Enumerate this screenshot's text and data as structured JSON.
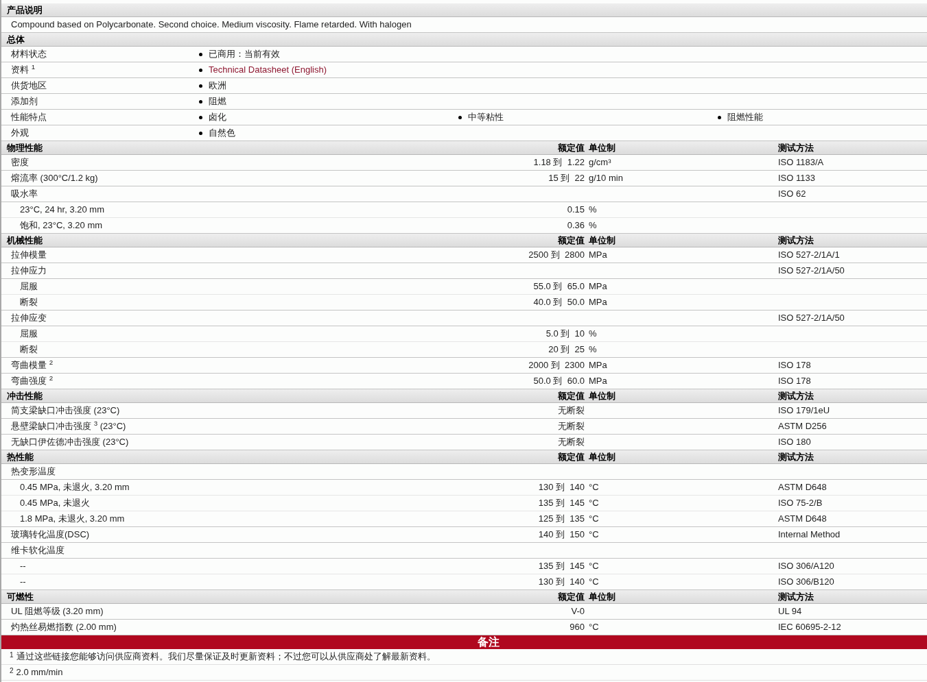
{
  "product_description": {
    "title": "产品说明",
    "text": "Compound based on Polycarbonate. Second choice. Medium viscosity. Flame retarded. With halogen"
  },
  "general": {
    "title": "总体",
    "rows": [
      {
        "label": "材料状态",
        "values": [
          {
            "text": "已商用：当前有效",
            "kind": "text"
          }
        ]
      },
      {
        "label": "资料 $^{1}$",
        "values": [
          {
            "text": "Technical Datasheet (English)",
            "kind": "link"
          }
        ]
      },
      {
        "label": "供货地区",
        "values": [
          {
            "text": "欧洲",
            "kind": "text"
          }
        ]
      },
      {
        "label": "添加剂",
        "values": [
          {
            "text": "阻燃",
            "kind": "text"
          }
        ]
      },
      {
        "label": "性能特点",
        "values": [
          {
            "text": "卤化",
            "kind": "text"
          },
          {
            "text": "中等粘性",
            "kind": "text"
          },
          {
            "text": "阻燃性能",
            "kind": "text"
          }
        ]
      },
      {
        "label": "外观",
        "values": [
          {
            "text": "自然色",
            "kind": "text"
          }
        ]
      }
    ]
  },
  "property_sections": [
    {
      "title": "物理性能",
      "value_heading": "额定值",
      "unit_heading": "单位制",
      "method_heading": "测试方法",
      "rows": [
        {
          "label": "密度",
          "value": "1.18 到  1.22",
          "unit": "g/cm³",
          "method": "ISO 1183/A"
        },
        {
          "label": "熔流率  (300°C/1.2 kg)",
          "value": "15 到  22",
          "unit": "g/10 min",
          "method": "ISO 1133"
        },
        {
          "label": "吸水率",
          "method": "ISO 62",
          "children": [
            {
              "label": "23°C, 24 hr, 3.20 mm",
              "value": "0.15",
              "unit": "%"
            },
            {
              "label": "饱和, 23°C, 3.20 mm",
              "value": "0.36",
              "unit": "%"
            }
          ]
        }
      ]
    },
    {
      "title": "机械性能",
      "value_heading": "额定值",
      "unit_heading": "单位制",
      "method_heading": "测试方法",
      "rows": [
        {
          "label": "拉伸模量",
          "value": "2500 到  2800",
          "unit": "MPa",
          "method": "ISO 527-2/1A/1"
        },
        {
          "label": "拉伸应力",
          "method": "ISO 527-2/1A/50",
          "children": [
            {
              "label": "屈服",
              "value": "55.0 到  65.0",
              "unit": "MPa"
            },
            {
              "label": "断裂",
              "value": "40.0 到  50.0",
              "unit": "MPa"
            }
          ]
        },
        {
          "label": "拉伸应变",
          "method": "ISO 527-2/1A/50",
          "children": [
            {
              "label": "屈服",
              "value": "5.0 到  10",
              "unit": "%"
            },
            {
              "label": "断裂",
              "value": "20 到  25",
              "unit": "%"
            }
          ]
        },
        {
          "label": "弯曲模量 $^{2}$",
          "value": "2000 到  2300",
          "unit": "MPa",
          "method": "ISO 178"
        },
        {
          "label": "弯曲强度 $^{2}$",
          "value": "50.0 到  60.0",
          "unit": "MPa",
          "method": "ISO 178"
        }
      ]
    },
    {
      "title": "冲击性能",
      "value_heading": "额定值",
      "unit_heading": "单位制",
      "method_heading": "测试方法",
      "rows": [
        {
          "label": "简支梁缺口冲击强度  (23°C)",
          "value": "无断裂",
          "method": "ISO 179/1eU"
        },
        {
          "label": "悬壁梁缺口冲击强度 $^{3}$ (23°C)",
          "value": "无断裂",
          "method": "ASTM D256"
        },
        {
          "label": "无缺口伊佐德冲击强度  (23°C)",
          "value": "无断裂",
          "method": "ISO 180"
        }
      ]
    },
    {
      "title": "热性能",
      "value_heading": "额定值",
      "unit_heading": "单位制",
      "method_heading": "测试方法",
      "rows": [
        {
          "label": "热变形温度",
          "children": [
            {
              "label": "0.45 MPa, 未退火, 3.20 mm",
              "value": "130 到  140",
              "unit": "°C",
              "method": "ASTM D648"
            },
            {
              "label": "0.45 MPa, 未退火",
              "value": "135 到  145",
              "unit": "°C",
              "method": "ISO 75-2/B"
            },
            {
              "label": "1.8 MPa, 未退火, 3.20 mm",
              "value": "125 到  135",
              "unit": "°C",
              "method": "ASTM D648"
            }
          ]
        },
        {
          "label": "玻璃转化温度(DSC)",
          "value": "140 到  150",
          "unit": "°C",
          "method": "Internal Method"
        },
        {
          "label": "维卡软化温度",
          "children": [
            {
              "label": "--",
              "value": "135 到  145",
              "unit": "°C",
              "method": "ISO 306/A120"
            },
            {
              "label": "--",
              "value": "130 到  140",
              "unit": "°C",
              "method": "ISO 306/B120"
            }
          ]
        }
      ]
    },
    {
      "title": "可燃性",
      "value_heading": "额定值",
      "unit_heading": "单位制",
      "method_heading": "测试方法",
      "rows": [
        {
          "label": "UL 阻燃等级  (3.20 mm)",
          "value": "V-0",
          "method": "UL 94"
        },
        {
          "label": "灼热丝易燃指数  (2.00 mm)",
          "value": "960",
          "unit": "°C",
          "method": "IEC 60695-2-12"
        }
      ]
    }
  ],
  "notes": {
    "title": "备注",
    "items": [
      {
        "mark": "1",
        "text": "通过这些链接您能够访问供应商资料。我们尽量保证及时更新资料；不过您可以从供应商处了解最新资料。"
      },
      {
        "mark": "2",
        "text": "2.0 mm/min"
      }
    ]
  }
}
